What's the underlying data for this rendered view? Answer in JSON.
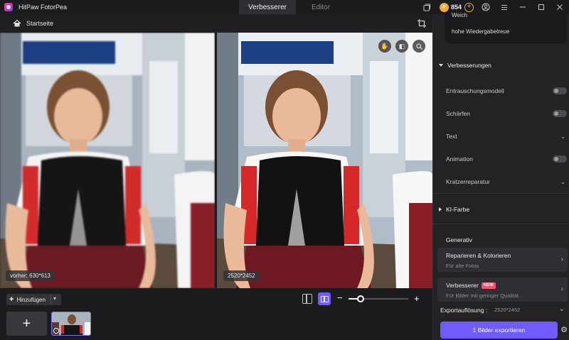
{
  "app": {
    "title": "HitPaw FotorPea"
  },
  "tabs": [
    {
      "label": "Verbesserer"
    },
    {
      "label": "Editor"
    }
  ],
  "titlebar": {
    "credits": "854"
  },
  "breadcrumb": {
    "label": "Startseite"
  },
  "canvas": {
    "before_label": "vorher: 630*613",
    "after_label": "2520*2452"
  },
  "bottom": {
    "add_label": "Hinzufügen",
    "zoom_level": 0.2
  },
  "panel": {
    "model_options": [
      "Weich",
      "hohe Wiedergabetreue"
    ],
    "enhance_header": "Verbesserungen",
    "enhance_items": [
      {
        "label": "Entrauschungsmodell",
        "control": "toggle"
      },
      {
        "label": "Schärfen",
        "control": "toggle"
      },
      {
        "label": "Text",
        "control": "dropdown"
      },
      {
        "label": "Animation",
        "control": "toggle"
      },
      {
        "label": "Kratzerreparatur",
        "control": "dropdown"
      }
    ],
    "ki_header": "KI-Farbe",
    "generative_header": "Generativ",
    "cards": [
      {
        "title": "Reparieren & Kolorieren",
        "subtitle": "Für alte Fotos",
        "badge": ""
      },
      {
        "title": "Verbesserer",
        "subtitle": "Für Bilder mit geringer Qualität",
        "badge": "NEW"
      }
    ],
    "export_res_label": "Exportauflösung :",
    "export_res_value": "2520*2452",
    "export_button": "1 Bilder exportieren"
  },
  "colors": {
    "accent": "#6f5cff",
    "badge": "#ff4d6d",
    "coin": "#f2a93b"
  }
}
